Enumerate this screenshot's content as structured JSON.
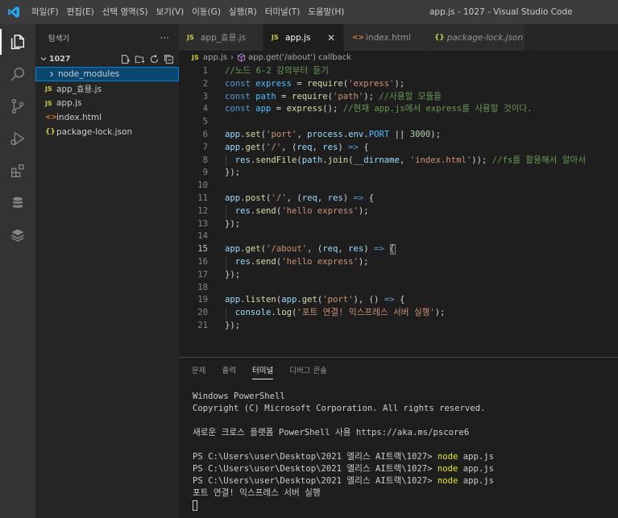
{
  "titlebar": {
    "menu": [
      "파일(F)",
      "편집(E)",
      "선택 영역(S)",
      "보기(V)",
      "이동(G)",
      "실행(R)",
      "터미널(T)",
      "도움말(H)"
    ],
    "window_title": "app.js - 1027 - Visual Studio Code"
  },
  "activity": {
    "items": [
      "files-icon",
      "search-icon",
      "source-control-icon",
      "run-debug-icon",
      "extensions-icon",
      "database-icon",
      "layers-icon"
    ]
  },
  "sidebar": {
    "title": "탐색기",
    "more": "···",
    "folder": "1027",
    "items": [
      {
        "label": "node_modules",
        "kind": "folder"
      },
      {
        "label": "app_효용.js",
        "kind": "js"
      },
      {
        "label": "app.js",
        "kind": "js"
      },
      {
        "label": "index.html",
        "kind": "html"
      },
      {
        "label": "package-lock.json",
        "kind": "json"
      }
    ]
  },
  "tabs": [
    {
      "label": "app_효용.js",
      "icon": "JS"
    },
    {
      "label": "app.js",
      "icon": "JS"
    },
    {
      "label": "index.html",
      "icon": "<>"
    },
    {
      "label": "package-lock.json",
      "icon": "{}"
    }
  ],
  "file_icons": {
    "js": "JS",
    "html": "<>",
    "json": "{}"
  },
  "breadcrumb": {
    "file": "app.js",
    "symbol": "app.get('/about') callback"
  },
  "editor": {
    "current_line": 15,
    "lines": [
      [
        [
          "c-cm",
          "//노드 6-2 강의부터 듣기"
        ]
      ],
      [
        [
          "c-kw",
          "const "
        ],
        [
          "c-const",
          "express"
        ],
        [
          "c-pl",
          " = "
        ],
        [
          "c-fn",
          "require"
        ],
        [
          "c-pl",
          "("
        ],
        [
          "c-str",
          "'express'"
        ],
        [
          "c-pl",
          ");"
        ]
      ],
      [
        [
          "c-kw",
          "const "
        ],
        [
          "c-const",
          "path"
        ],
        [
          "c-pl",
          " = "
        ],
        [
          "c-fn",
          "require"
        ],
        [
          "c-pl",
          "("
        ],
        [
          "c-str",
          "'path'"
        ],
        [
          "c-pl",
          "); "
        ],
        [
          "c-cm",
          "//사용할 모듈들"
        ]
      ],
      [
        [
          "c-kw",
          "const "
        ],
        [
          "c-const",
          "app"
        ],
        [
          "c-pl",
          " = "
        ],
        [
          "c-fn",
          "express"
        ],
        [
          "c-pl",
          "(); "
        ],
        [
          "c-cm",
          "//현재 app.js에서 express를 사용할 것이다."
        ]
      ],
      [],
      [
        [
          "c-var",
          "app"
        ],
        [
          "c-pl",
          "."
        ],
        [
          "c-fn",
          "set"
        ],
        [
          "c-pl",
          "("
        ],
        [
          "c-str",
          "'port'"
        ],
        [
          "c-pl",
          ", "
        ],
        [
          "c-var",
          "process"
        ],
        [
          "c-pl",
          "."
        ],
        [
          "c-var",
          "env"
        ],
        [
          "c-pl",
          "."
        ],
        [
          "c-const",
          "PORT"
        ],
        [
          "c-pl",
          " || "
        ],
        [
          "c-num",
          "3000"
        ],
        [
          "c-pl",
          ");"
        ]
      ],
      [
        [
          "c-var",
          "app"
        ],
        [
          "c-pl",
          "."
        ],
        [
          "c-fn",
          "get"
        ],
        [
          "c-pl",
          "("
        ],
        [
          "c-str",
          "'/'"
        ],
        [
          "c-pl",
          ", ("
        ],
        [
          "c-var",
          "req"
        ],
        [
          "c-pl",
          ", "
        ],
        [
          "c-var",
          "res"
        ],
        [
          "c-pl",
          ") "
        ],
        [
          "c-kw",
          "=>"
        ],
        [
          "c-pl",
          " {"
        ]
      ],
      [
        [
          "c-pl",
          "  "
        ],
        [
          "c-var",
          "res"
        ],
        [
          "c-pl",
          "."
        ],
        [
          "c-fn",
          "sendFile"
        ],
        [
          "c-pl",
          "("
        ],
        [
          "c-var",
          "path"
        ],
        [
          "c-pl",
          "."
        ],
        [
          "c-fn",
          "join"
        ],
        [
          "c-pl",
          "("
        ],
        [
          "c-var",
          "__dirname"
        ],
        [
          "c-pl",
          ", "
        ],
        [
          "c-str",
          "'index.html'"
        ],
        [
          "c-pl",
          ")); "
        ],
        [
          "c-cm",
          "//fs를 활용해서 알아서"
        ]
      ],
      [
        [
          "c-pl",
          "});"
        ]
      ],
      [],
      [
        [
          "c-var",
          "app"
        ],
        [
          "c-pl",
          "."
        ],
        [
          "c-fn",
          "post"
        ],
        [
          "c-pl",
          "("
        ],
        [
          "c-str",
          "'/'"
        ],
        [
          "c-pl",
          ", ("
        ],
        [
          "c-var",
          "req"
        ],
        [
          "c-pl",
          ", "
        ],
        [
          "c-var",
          "res"
        ],
        [
          "c-pl",
          ") "
        ],
        [
          "c-kw",
          "=>"
        ],
        [
          "c-pl",
          " {"
        ]
      ],
      [
        [
          "c-pl",
          "  "
        ],
        [
          "c-var",
          "res"
        ],
        [
          "c-pl",
          "."
        ],
        [
          "c-fn",
          "send"
        ],
        [
          "c-pl",
          "("
        ],
        [
          "c-str",
          "'hello express'"
        ],
        [
          "c-pl",
          ");"
        ]
      ],
      [
        [
          "c-pl",
          "});"
        ]
      ],
      [],
      [
        [
          "c-var",
          "app"
        ],
        [
          "c-pl",
          "."
        ],
        [
          "c-fn",
          "get"
        ],
        [
          "c-pl",
          "("
        ],
        [
          "c-str",
          "'/about'"
        ],
        [
          "c-pl",
          ", ("
        ],
        [
          "c-var",
          "req"
        ],
        [
          "c-pl",
          ", "
        ],
        [
          "c-var",
          "res"
        ],
        [
          "c-pl",
          ") "
        ],
        [
          "c-kw",
          "=>"
        ],
        [
          "c-pl",
          " {"
        ]
      ],
      [
        [
          "c-pl",
          "  "
        ],
        [
          "c-var",
          "res"
        ],
        [
          "c-pl",
          "."
        ],
        [
          "c-fn",
          "send"
        ],
        [
          "c-pl",
          "("
        ],
        [
          "c-str",
          "'hello express'"
        ],
        [
          "c-pl",
          ");"
        ]
      ],
      [
        [
          "c-pl",
          "});"
        ]
      ],
      [],
      [
        [
          "c-var",
          "app"
        ],
        [
          "c-pl",
          "."
        ],
        [
          "c-fn",
          "listen"
        ],
        [
          "c-pl",
          "("
        ],
        [
          "c-var",
          "app"
        ],
        [
          "c-pl",
          "."
        ],
        [
          "c-fn",
          "get"
        ],
        [
          "c-pl",
          "("
        ],
        [
          "c-str",
          "'port'"
        ],
        [
          "c-pl",
          "), () "
        ],
        [
          "c-kw",
          "=>"
        ],
        [
          "c-pl",
          " {"
        ]
      ],
      [
        [
          "c-pl",
          "  "
        ],
        [
          "c-var",
          "console"
        ],
        [
          "c-pl",
          "."
        ],
        [
          "c-fn",
          "log"
        ],
        [
          "c-pl",
          "("
        ],
        [
          "c-str",
          "'포트 연결! 익스프레스 서버 실행'"
        ],
        [
          "c-pl",
          ");"
        ]
      ],
      [
        [
          "c-pl",
          "});"
        ]
      ]
    ]
  },
  "panel": {
    "tabs": [
      "문제",
      "출력",
      "터미널",
      "디버그 콘솔"
    ],
    "active_tab": "터미널",
    "terminal": [
      [
        [
          "",
          "Windows PowerShell"
        ]
      ],
      [
        [
          "",
          "Copyright (C) Microsoft Corporation. All rights reserved."
        ]
      ],
      [],
      [
        [
          "",
          "새로운 크로스 플랫폼 PowerShell 사용 https://aka.ms/pscore6"
        ]
      ],
      [],
      [
        [
          "",
          "PS C:\\Users\\user\\Desktop\\2021 엘리스 AI트랙\\1027> "
        ],
        [
          "t-y",
          "node"
        ],
        [
          "",
          " app.js"
        ]
      ],
      [
        [
          "",
          "PS C:\\Users\\user\\Desktop\\2021 엘리스 AI트랙\\1027> "
        ],
        [
          "t-y",
          "node"
        ],
        [
          "",
          " app.js"
        ]
      ],
      [
        [
          "",
          "PS C:\\Users\\user\\Desktop\\2021 엘리스 AI트랙\\1027> "
        ],
        [
          "t-y",
          "node"
        ],
        [
          "",
          " app.js"
        ]
      ],
      [
        [
          "",
          "포트 연결! 익스프레스 서버 실행"
        ]
      ]
    ]
  },
  "colors": {
    "accent": "#007acc",
    "titlebar": "#3c3c3c",
    "activitybar": "#333333",
    "sidebar": "#252526",
    "editor": "#1e1e1e",
    "selection": "#094771"
  }
}
